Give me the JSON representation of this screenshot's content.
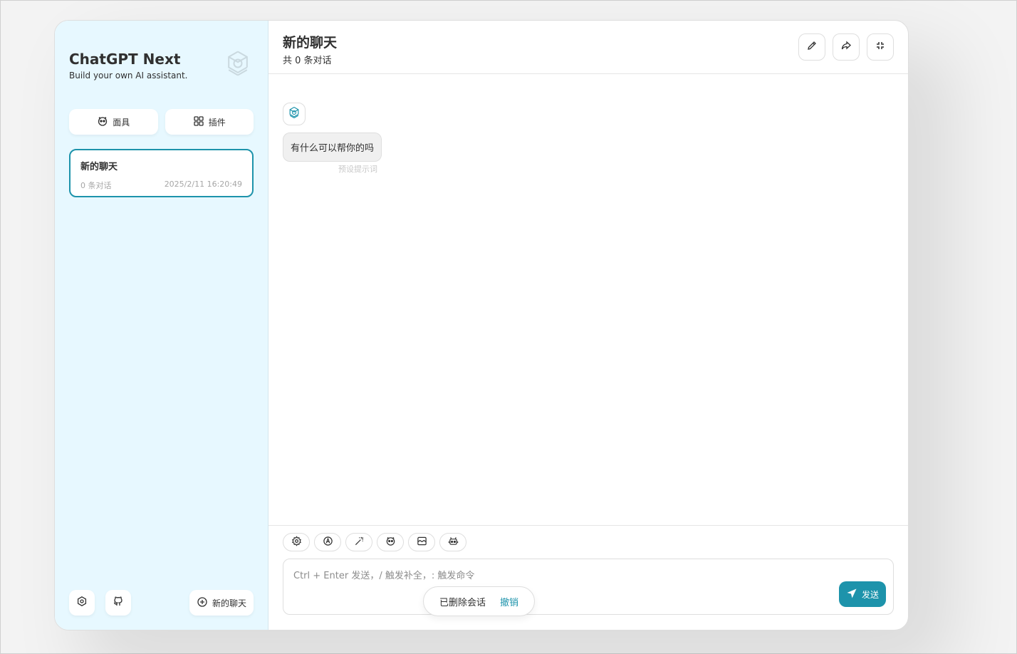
{
  "sidebar": {
    "title": "ChatGPT Next",
    "subtitle": "Build your own AI assistant.",
    "logo_icon": "openai-logo-icon",
    "masks_label": "面具",
    "plugins_label": "插件",
    "chats": [
      {
        "title": "新的聊天",
        "count": "0 条对话",
        "time": "2025/2/11 16:20:49"
      }
    ],
    "settings_icon": "settings-icon",
    "github_icon": "github-icon",
    "new_chat_label": "新的聊天"
  },
  "header": {
    "title": "新的聊天",
    "subtitle": "共 0 条对话",
    "actions": [
      "edit-icon",
      "share-icon",
      "fullscreen-icon"
    ]
  },
  "messages": [
    {
      "role": "assistant",
      "text": "有什么可以帮你的吗",
      "meta": "预设提示词"
    }
  ],
  "toolbar": {
    "tools": [
      "settings-icon",
      "theme-auto-icon",
      "prompt-magic-icon",
      "mask-icon",
      "context-icon",
      "robot-icon"
    ]
  },
  "input": {
    "placeholder": "Ctrl + Enter 发送，/ 触发补全，: 触发命令",
    "value": "",
    "send_label": "发送"
  },
  "toast": {
    "message": "已删除会话",
    "action": "撤销"
  },
  "colors": {
    "accent": "#1d93ab",
    "sidebar_bg": "#e7f8ff"
  }
}
